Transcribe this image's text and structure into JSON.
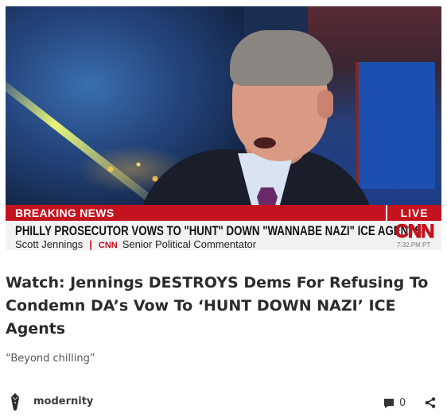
{
  "video_frame": {
    "breaking_label": "BREAKING NEWS",
    "live_label": "LIVE",
    "headline": "PHILLY PROSECUTOR VOWS TO \"HUNT\" DOWN \"WANNABE NAZI\" ICE AGENTS",
    "guest_name": "Scott Jennings",
    "separator": "|",
    "network_small": "CNN",
    "guest_role": "Senior Political Commentator",
    "network_logo": "CNN",
    "timestamp": "7:32 PM PT"
  },
  "article": {
    "title": "Watch: Jennings DESTROYS Dems For Refusing To Condemn DA’s Vow To ‘HUNT DOWN NAZI’ ICE Agents",
    "subtitle": "“Beyond chilling”"
  },
  "footer": {
    "author": "modernity",
    "comment_count": "0",
    "icons": [
      "avatar",
      "comment-icon",
      "share-icon"
    ]
  },
  "colors": {
    "accent_red": "#c4121f",
    "text_dark": "#2b2b2b"
  }
}
